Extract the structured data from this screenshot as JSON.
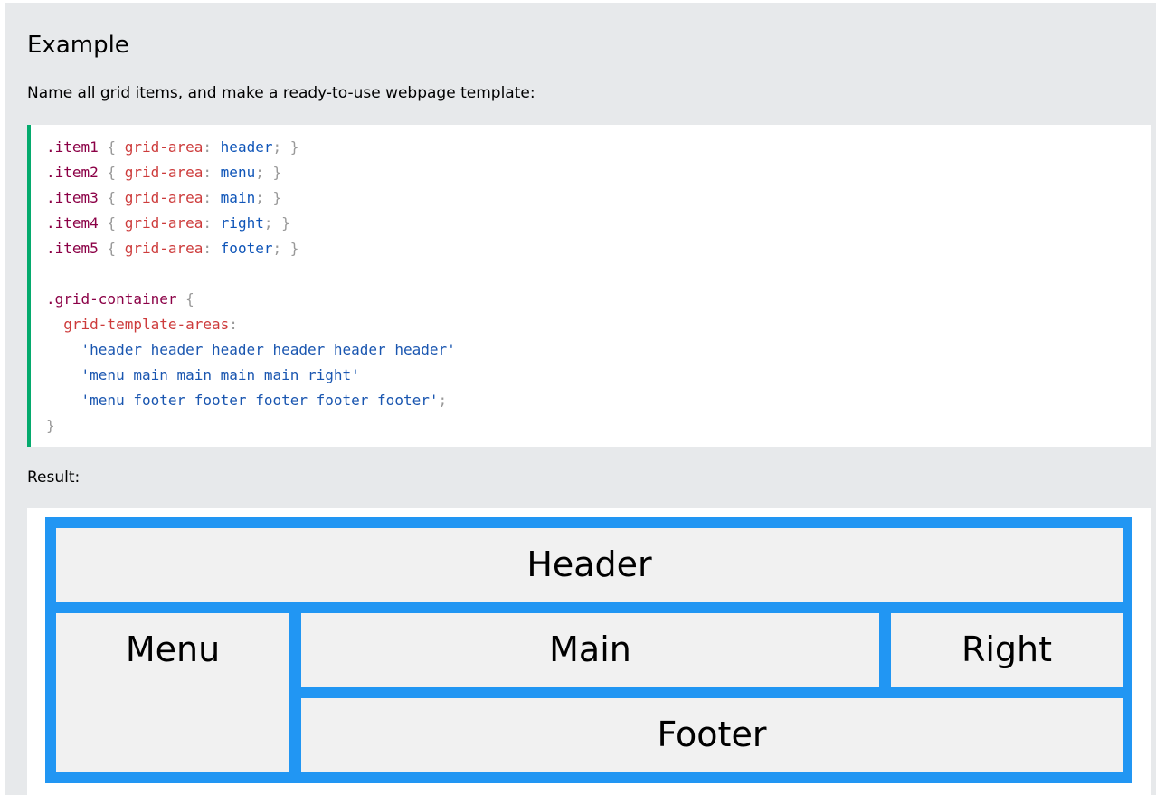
{
  "example": {
    "title": "Example",
    "description": "Name all grid items, and make a ready-to-use webpage template:"
  },
  "code": {
    "lines": [
      [
        {
          "t": "sel",
          "v": ".item1"
        },
        {
          "t": "brace",
          "v": " { "
        },
        {
          "t": "prop",
          "v": "grid-area"
        },
        {
          "t": "brace",
          "v": ": "
        },
        {
          "t": "val",
          "v": "header"
        },
        {
          "t": "brace",
          "v": "; }"
        }
      ],
      [
        {
          "t": "sel",
          "v": ".item2"
        },
        {
          "t": "brace",
          "v": " { "
        },
        {
          "t": "prop",
          "v": "grid-area"
        },
        {
          "t": "brace",
          "v": ": "
        },
        {
          "t": "val",
          "v": "menu"
        },
        {
          "t": "brace",
          "v": "; }"
        }
      ],
      [
        {
          "t": "sel",
          "v": ".item3"
        },
        {
          "t": "brace",
          "v": " { "
        },
        {
          "t": "prop",
          "v": "grid-area"
        },
        {
          "t": "brace",
          "v": ": "
        },
        {
          "t": "val",
          "v": "main"
        },
        {
          "t": "brace",
          "v": "; }"
        }
      ],
      [
        {
          "t": "sel",
          "v": ".item4"
        },
        {
          "t": "brace",
          "v": " { "
        },
        {
          "t": "prop",
          "v": "grid-area"
        },
        {
          "t": "brace",
          "v": ": "
        },
        {
          "t": "val",
          "v": "right"
        },
        {
          "t": "brace",
          "v": "; }"
        }
      ],
      [
        {
          "t": "sel",
          "v": ".item5"
        },
        {
          "t": "brace",
          "v": " { "
        },
        {
          "t": "prop",
          "v": "grid-area"
        },
        {
          "t": "brace",
          "v": ": "
        },
        {
          "t": "val",
          "v": "footer"
        },
        {
          "t": "brace",
          "v": "; }"
        }
      ],
      [],
      [
        {
          "t": "sel",
          "v": ".grid-container"
        },
        {
          "t": "brace",
          "v": " {"
        }
      ],
      [
        {
          "t": "prop",
          "v": "  grid-template-areas"
        },
        {
          "t": "brace",
          "v": ":"
        }
      ],
      [
        {
          "t": "str",
          "v": "    'header header header header header header'"
        }
      ],
      [
        {
          "t": "str",
          "v": "    'menu main main main main right'"
        }
      ],
      [
        {
          "t": "str",
          "v": "    'menu footer footer footer footer footer'"
        },
        {
          "t": "brace",
          "v": ";"
        }
      ],
      [
        {
          "t": "brace",
          "v": "}"
        }
      ]
    ]
  },
  "result": {
    "label": "Result:",
    "items": {
      "header": "Header",
      "menu": "Menu",
      "main": "Main",
      "right": "Right",
      "footer": "Footer"
    }
  },
  "colors": {
    "panel_bg": "#e7e9eb",
    "code_accent": "#04aa6d",
    "grid_bg": "#2196f3",
    "item_bg": "#f1f1f1"
  }
}
